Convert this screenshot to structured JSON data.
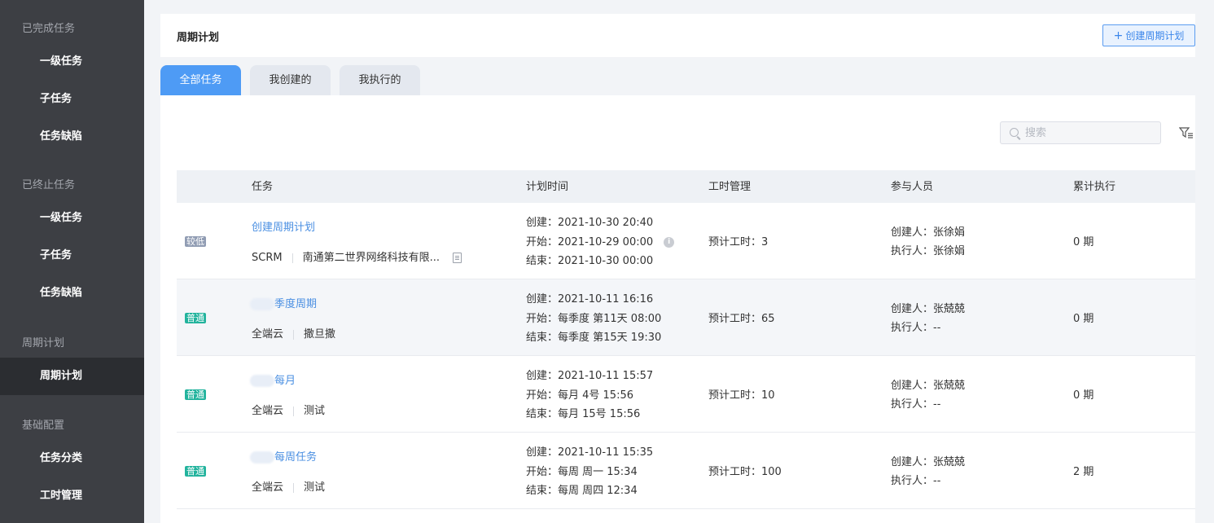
{
  "sidebar": {
    "sections": [
      {
        "header": "已完成任务",
        "items": [
          "一级任务",
          "子任务",
          "任务缺陷"
        ]
      },
      {
        "header": "已终止任务",
        "items": [
          "一级任务",
          "子任务",
          "任务缺陷"
        ]
      },
      {
        "header": "周期计划",
        "items": [
          "周期计划"
        ]
      },
      {
        "header": "基础配置",
        "items": [
          "任务分类",
          "工时管理"
        ]
      }
    ],
    "active_item": "周期计划"
  },
  "header": {
    "title": "周期计划",
    "create_button": "创建周期计划",
    "create_icon": "plus-icon"
  },
  "tabs": [
    "全部任务",
    "我创建的",
    "我执行的"
  ],
  "active_tab": "全部任务",
  "search": {
    "placeholder": "搜索",
    "icon": "search-icon"
  },
  "filter_icon": "filter-icon",
  "table": {
    "columns": [
      "任务",
      "计划时间",
      "工时管理",
      "参与人员",
      "累计执行"
    ],
    "rows": [
      {
        "priority": "较低",
        "priority_color": "#909cb3",
        "title": "创建周期计划",
        "project": "SCRM",
        "company": "南通第二世界网络科技有限...",
        "created": "创建：2021-10-30 20:40",
        "start": "开始：2021-10-29 00:00",
        "end": "结束：2021-10-30 00:00",
        "hours": "预计工时：3",
        "creator": "创建人：张徐娟",
        "executor": "执行人：张徐娟",
        "executed": "0 期"
      },
      {
        "priority": "普通",
        "priority_color": "#22b39d",
        "title": "季度周期",
        "project": "全端云",
        "company": "撒旦撒",
        "created": "创建：2021-10-11 16:16",
        "start": "开始：每季度 第11天 08:00",
        "end": "结束：每季度 第15天 19:30",
        "hours": "预计工时：65",
        "creator": "创建人：张兢兢",
        "executor": "执行人：--",
        "executed": "0 期"
      },
      {
        "priority": "普通",
        "priority_color": "#22b39d",
        "title": "每月",
        "project": "全端云",
        "company": "测试",
        "created": "创建：2021-10-11 15:57",
        "start": "开始：每月 4号 15:56",
        "end": "结束：每月 15号 15:56",
        "hours": "预计工时：10",
        "creator": "创建人：张兢兢",
        "executor": "执行人：--",
        "executed": "0 期"
      },
      {
        "priority": "普通",
        "priority_color": "#22b39d",
        "title": "每周任务",
        "project": "全端云",
        "company": "测试",
        "created": "创建：2021-10-11 15:35",
        "start": "开始：每周 周一 15:34",
        "end": "结束：每周 周四 12:34",
        "hours": "预计工时：100",
        "creator": "创建人：张兢兢",
        "executor": "执行人：--",
        "executed": "2 期"
      }
    ]
  }
}
